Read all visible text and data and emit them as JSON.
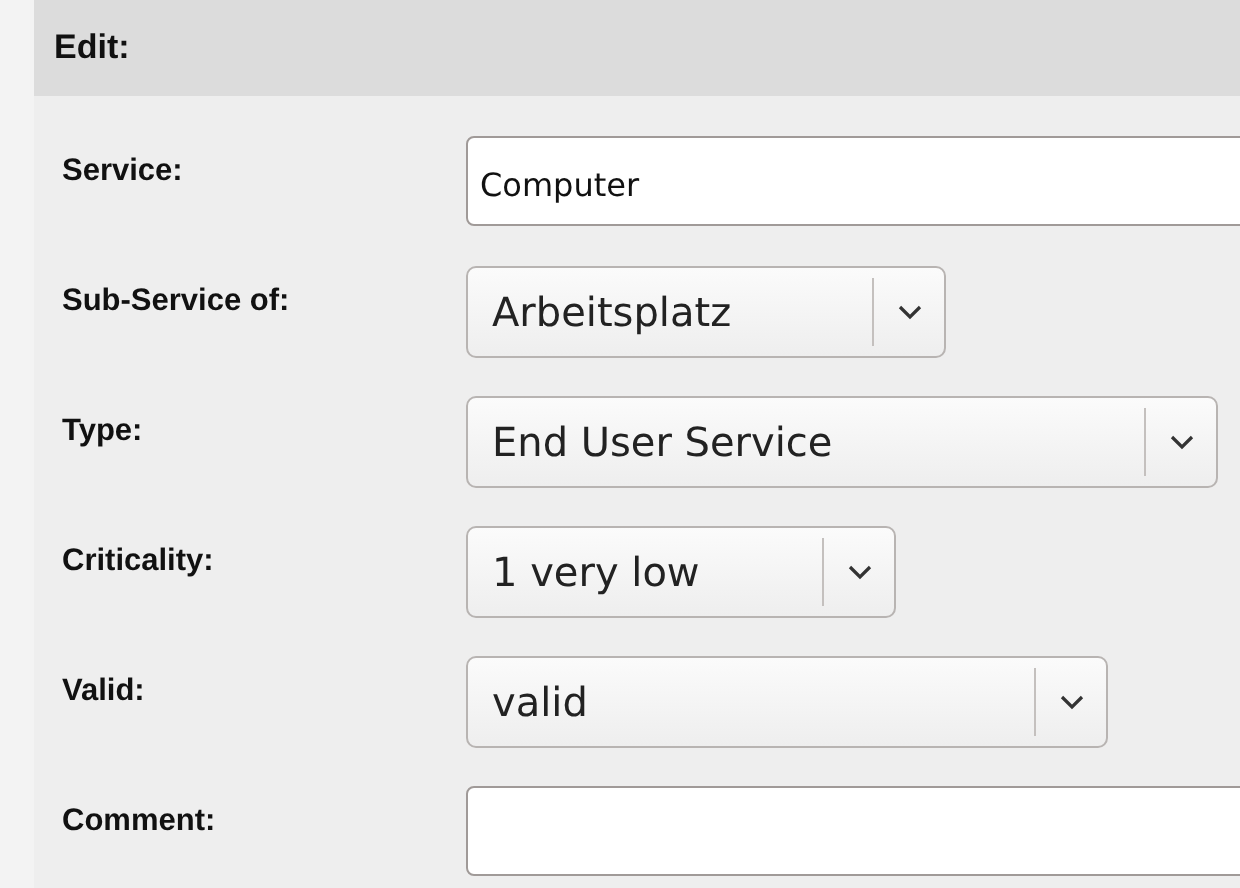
{
  "panel": {
    "title": "Edit:"
  },
  "fields": [
    {
      "label": "Service:",
      "kind": "text",
      "value": "Computer"
    },
    {
      "label": "Sub-Service of:",
      "kind": "select",
      "value": "Arbeitsplatz"
    },
    {
      "label": "Type:",
      "kind": "select",
      "value": "End User Service"
    },
    {
      "label": "Criticality:",
      "kind": "select",
      "value": "1 very low"
    },
    {
      "label": "Valid:",
      "kind": "select",
      "value": "valid"
    },
    {
      "label": "Comment:",
      "kind": "text"
    }
  ]
}
